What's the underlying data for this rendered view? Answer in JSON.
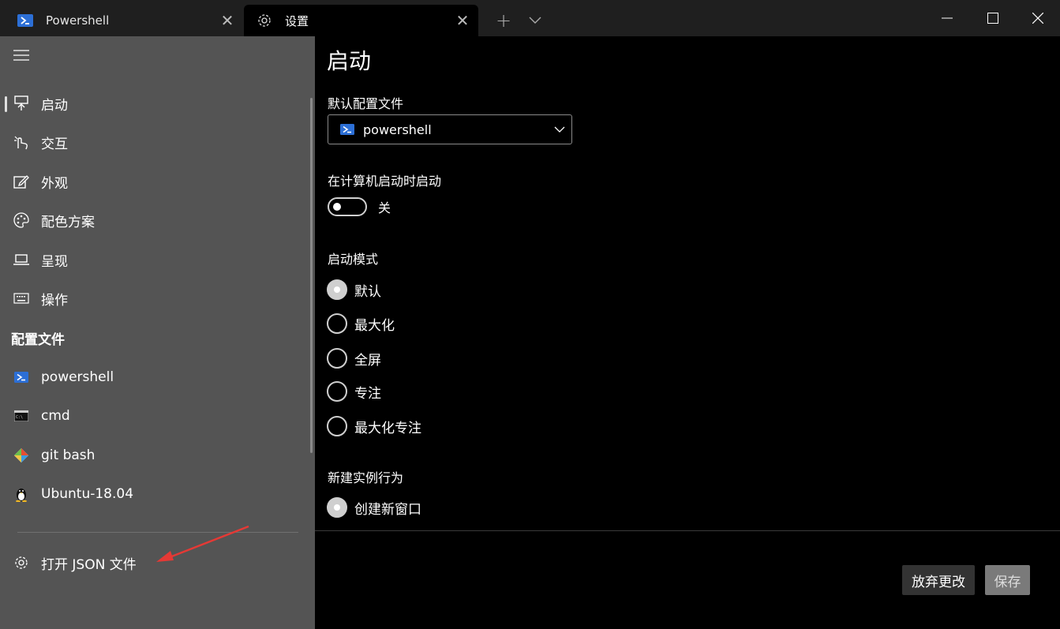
{
  "tabs": [
    {
      "label": "Powershell",
      "icon": "powershell-icon"
    },
    {
      "label": "设置",
      "icon": "gear-icon"
    }
  ],
  "window": {
    "new_tab": "+"
  },
  "sidebar": {
    "items": [
      {
        "label": "启动",
        "icon": "launch-icon"
      },
      {
        "label": "交互",
        "icon": "pointer-hand-icon"
      },
      {
        "label": "外观",
        "icon": "edit-icon"
      },
      {
        "label": "配色方案",
        "icon": "palette-icon"
      },
      {
        "label": "呈现",
        "icon": "laptop-icon"
      },
      {
        "label": "操作",
        "icon": "keyboard-icon"
      }
    ],
    "profiles_header": "配置文件",
    "profiles": [
      {
        "label": "powershell",
        "icon": "powershell-icon"
      },
      {
        "label": "cmd",
        "icon": "cmd-icon"
      },
      {
        "label": "git bash",
        "icon": "git-icon"
      },
      {
        "label": "Ubuntu-18.04",
        "icon": "linux-penguin-icon"
      }
    ],
    "open_json": "打开 JSON 文件"
  },
  "main": {
    "title": "启动",
    "default_profile_label": "默认配置文件",
    "default_profile_value": "powershell",
    "launch_on_startup_label": "在计算机启动时启动",
    "launch_on_startup_state": "关",
    "launch_mode_label": "启动模式",
    "launch_modes": [
      "默认",
      "最大化",
      "全屏",
      "专注",
      "最大化专注"
    ],
    "launch_mode_selected": "默认",
    "new_instance_label": "新建实例行为",
    "new_instance_options": [
      "创建新窗口"
    ],
    "new_instance_selected": "创建新窗口",
    "discard_label": "放弃更改",
    "save_label": "保存"
  },
  "colors": {
    "sidebar_bg": "#545454",
    "main_bg": "#000000",
    "titlebar_bg": "#1f1f1f",
    "powershell_blue": "#2c6fd6",
    "annotation_arrow": "#e53935"
  }
}
